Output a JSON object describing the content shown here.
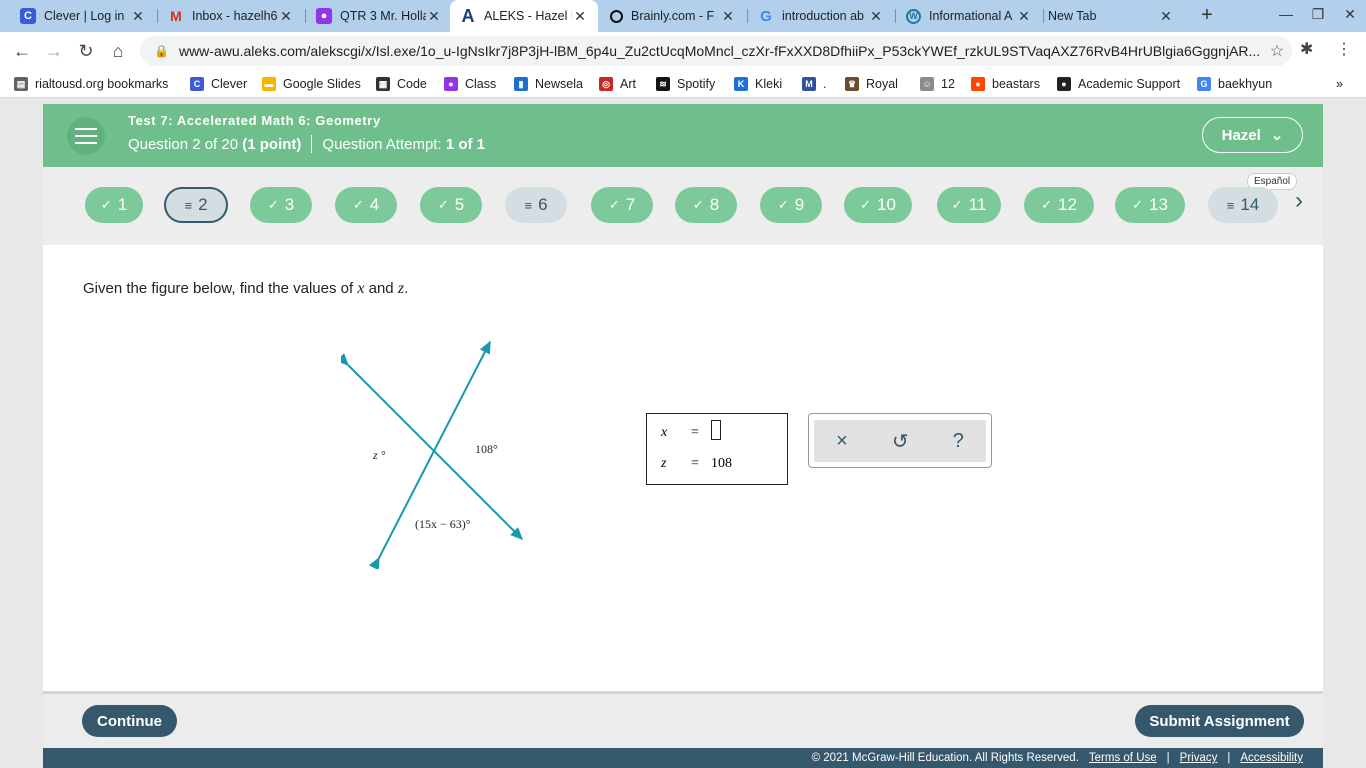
{
  "browser": {
    "tabs": [
      {
        "title": "Clever | Log in",
        "icon": "clever-icon",
        "color": "#3b5bdb"
      },
      {
        "title": "Inbox - hazelh6",
        "icon": "gmail-icon",
        "color": "#d93025"
      },
      {
        "title": "QTR 3 Mr. Holla",
        "icon": "classroom-icon",
        "color": "#9334e6"
      },
      {
        "title": "ALEKS - Hazel H",
        "icon": "aleks-icon",
        "color": "#1a3d7c",
        "active": true
      },
      {
        "title": "Brainly.com - F",
        "icon": "brainly-icon",
        "color": "#111111"
      },
      {
        "title": "introduction ab",
        "icon": "google-icon",
        "color": "#4285f4"
      },
      {
        "title": "Informational A",
        "icon": "wordpress-icon",
        "color": "#21759b"
      },
      {
        "title": "New Tab",
        "icon": "",
        "color": ""
      }
    ],
    "url": "www-awu.aleks.com/alekscgi/x/Isl.exe/1o_u-IgNsIkr7j8P3jH-lBM_6p4u_Zu2ctUcqMoMncl_czXr-fFxXXD8DfhiiPx_P53ckYWEf_rzkUL9STVaqAXZ76RvB4HrUBlgia6GggnjAR...",
    "bookmarks": [
      {
        "label": "rialtousd.org bookmarks",
        "icon": "folder-icon",
        "color": "#5f6368"
      },
      {
        "label": "Clever",
        "icon": "clever-icon",
        "color": "#3b5bdb"
      },
      {
        "label": "Google Slides",
        "icon": "slides-icon",
        "color": "#f4b400"
      },
      {
        "label": "Code",
        "icon": "code-icon",
        "color": "#333333"
      },
      {
        "label": "Class",
        "icon": "class-icon",
        "color": "#9334e6"
      },
      {
        "label": "Newsela",
        "icon": "newsela-icon",
        "color": "#1c6fd1"
      },
      {
        "label": "Art",
        "icon": "art-icon",
        "color": "#c62828"
      },
      {
        "label": "Spotify",
        "icon": "spotify-icon",
        "color": "#191414"
      },
      {
        "label": "Kleki",
        "icon": "kleki-icon",
        "color": "#1e6fd9"
      },
      {
        "label": ".",
        "icon": "mal-icon",
        "color": "#2e51a2"
      },
      {
        "label": "Royal",
        "icon": "royal-icon",
        "color": "#6b4f2a"
      },
      {
        "label": "12",
        "icon": "twelve-icon",
        "color": "#8a8a8a"
      },
      {
        "label": "beastars",
        "icon": "reddit-icon",
        "color": "#ff4500"
      },
      {
        "label": "Academic Support",
        "icon": "globe-icon",
        "color": "#202124"
      },
      {
        "label": "baekhyun",
        "icon": "google-icon",
        "color": "#4285f4"
      }
    ]
  },
  "aleks": {
    "test_title": "Test 7: Accelerated Math 6: Geometry",
    "question_label": "Question 2 of 20",
    "points_label": "(1 point)",
    "attempt_label": "Question Attempt:",
    "attempt_value": "1 of 1",
    "user_name": "Hazel",
    "espanol": "Español",
    "questions": [
      {
        "num": "1",
        "status": "done"
      },
      {
        "num": "2",
        "status": "pending",
        "current": true
      },
      {
        "num": "3",
        "status": "done"
      },
      {
        "num": "4",
        "status": "done"
      },
      {
        "num": "5",
        "status": "done"
      },
      {
        "num": "6",
        "status": "pending"
      },
      {
        "num": "7",
        "status": "done"
      },
      {
        "num": "8",
        "status": "done"
      },
      {
        "num": "9",
        "status": "done"
      },
      {
        "num": "10",
        "status": "done"
      },
      {
        "num": "11",
        "status": "done"
      },
      {
        "num": "12",
        "status": "done"
      },
      {
        "num": "13",
        "status": "done"
      },
      {
        "num": "14",
        "status": "pending"
      }
    ],
    "prompt_before": "Given the figure below, find the values of ",
    "prompt_var1": "x",
    "prompt_mid": " and ",
    "prompt_var2": "z",
    "prompt_end": ".",
    "figure": {
      "label_z": "z °",
      "label_108": "108°",
      "label_expr": "(15x − 63)°"
    },
    "answers": {
      "x_var": "x",
      "x_eq": "=",
      "x_value": "",
      "z_var": "z",
      "z_eq": "=",
      "z_value": "108"
    },
    "tools": {
      "clear": "×",
      "undo": "↺",
      "help": "?"
    },
    "continue_label": "Continue",
    "submit_label": "Submit Assignment",
    "footer": {
      "copyright": "© 2021 McGraw-Hill Education. All Rights Reserved.",
      "terms": "Terms of Use",
      "privacy": "Privacy",
      "accessibility": "Accessibility"
    }
  }
}
